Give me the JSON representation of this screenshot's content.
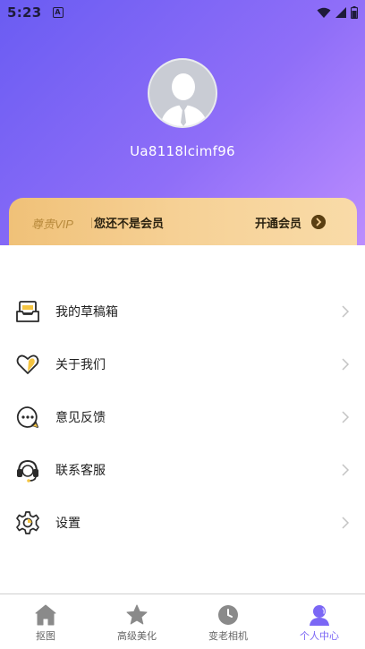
{
  "status_bar": {
    "time": "5:23",
    "notification_badge": "A"
  },
  "profile": {
    "username": "Ua8118lcimf96"
  },
  "vip": {
    "title": "尊贵VIP",
    "status": "您还不是会员",
    "open_label": "开通会员"
  },
  "menu": [
    {
      "label": "我的草稿箱",
      "icon": "drafts-box-icon"
    },
    {
      "label": "关于我们",
      "icon": "heart-icon"
    },
    {
      "label": "意见反馈",
      "icon": "chat-bubble-icon"
    },
    {
      "label": "联系客服",
      "icon": "headset-icon"
    },
    {
      "label": "设置",
      "icon": "gear-icon"
    }
  ],
  "tabs": [
    {
      "label": "抠图",
      "icon": "home-icon",
      "active": false
    },
    {
      "label": "高级美化",
      "icon": "star-icon",
      "active": false
    },
    {
      "label": "变老相机",
      "icon": "clock-icon",
      "active": false
    },
    {
      "label": "个人中心",
      "icon": "person-icon",
      "active": true
    }
  ],
  "colors": {
    "accent": "#7b67f5",
    "header_start": "#6a5cf2",
    "header_end": "#c090ff",
    "vip_gold": "#f0c178"
  }
}
